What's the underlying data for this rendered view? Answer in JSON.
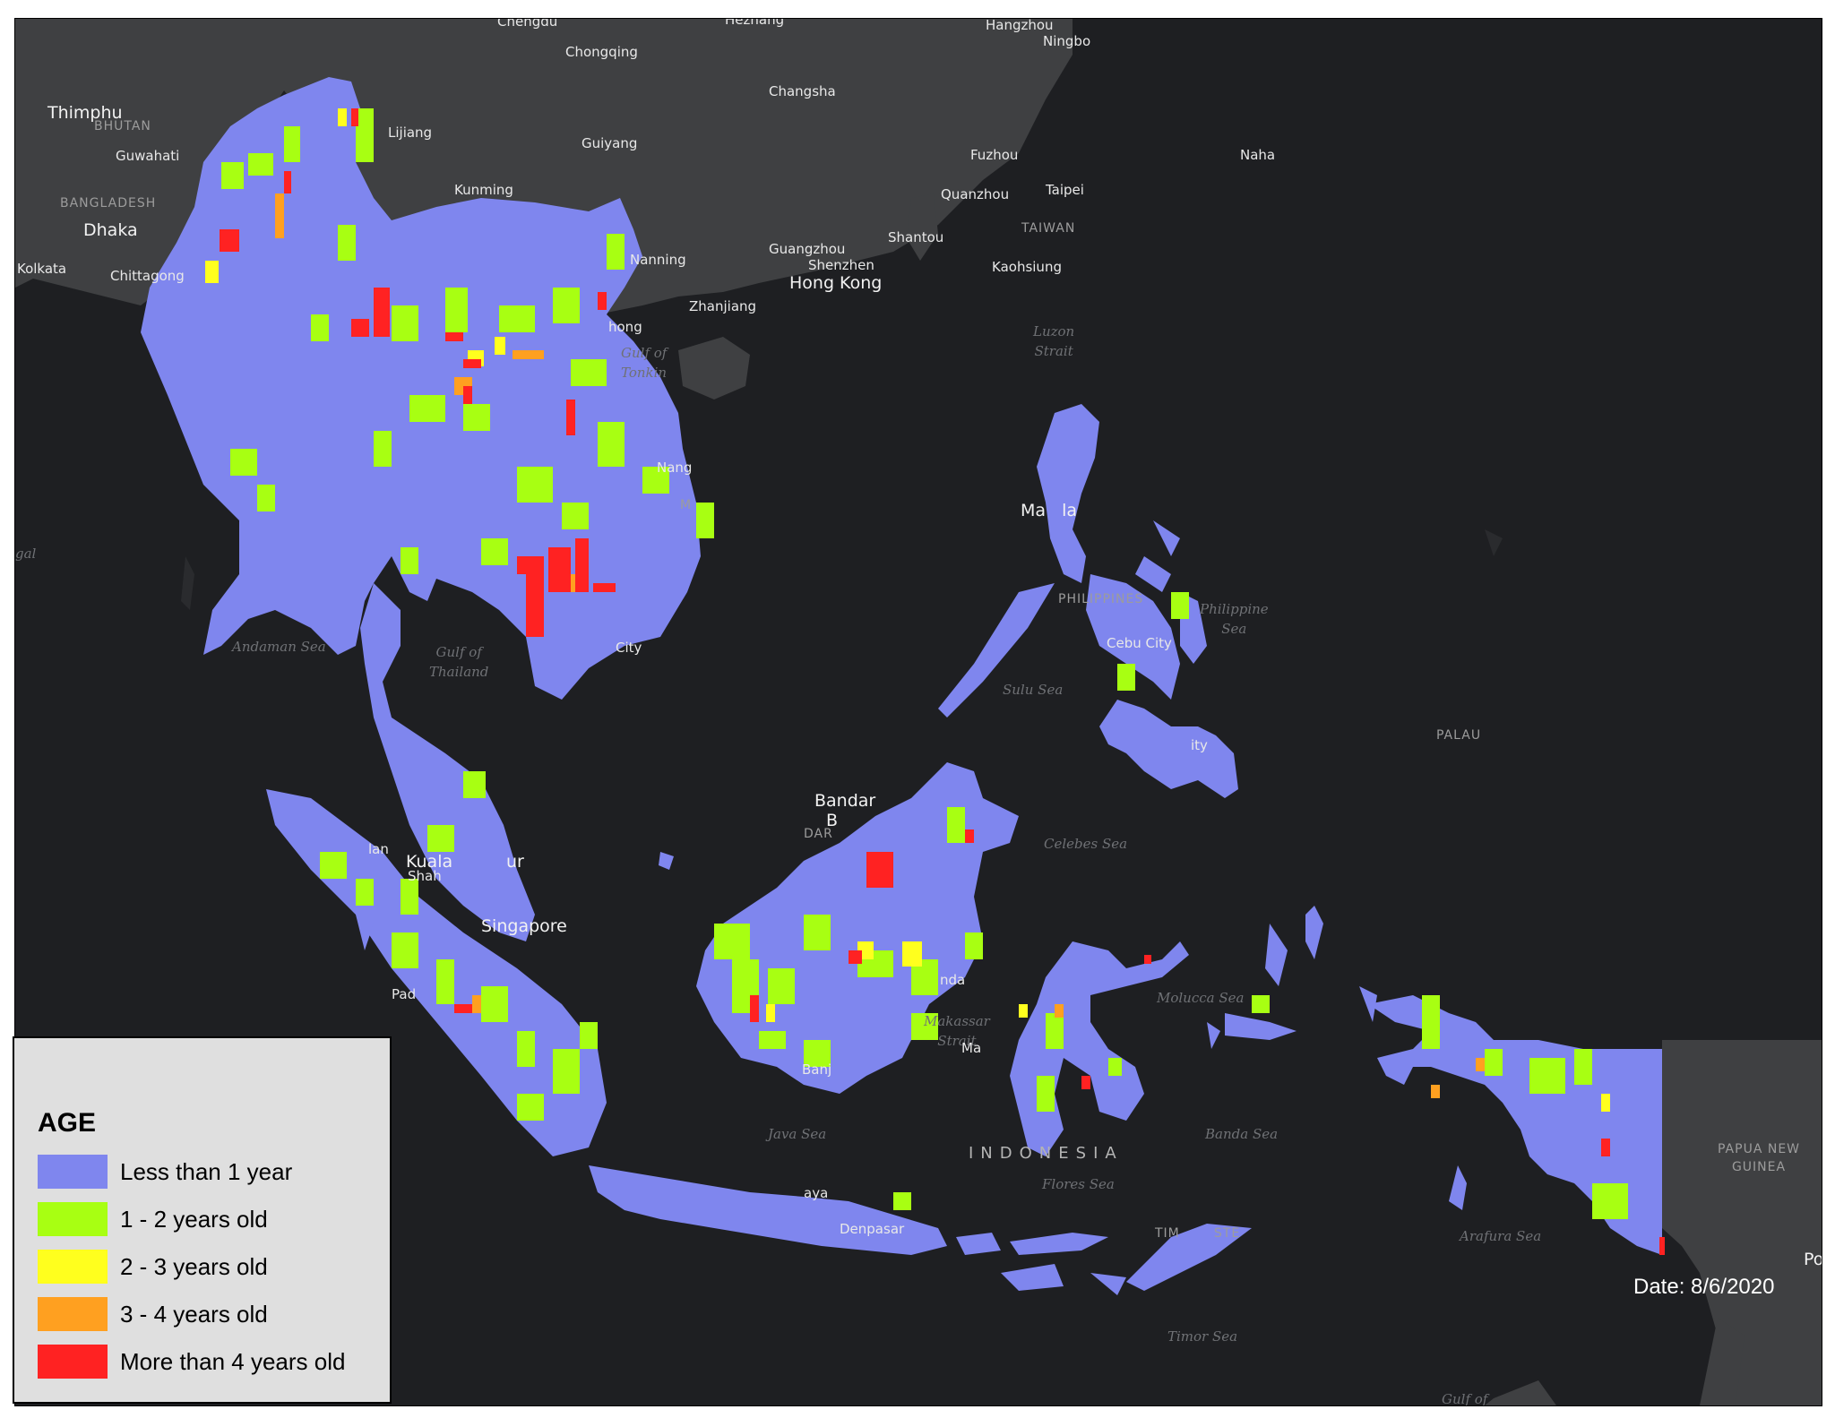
{
  "legend": {
    "title": "AGE",
    "items": [
      {
        "label": "Less than 1 year",
        "color": "#7f86ee"
      },
      {
        "label": "1 - 2 years old",
        "color": "#a8ff12"
      },
      {
        "label": "2 - 3 years old",
        "color": "#ffff1e"
      },
      {
        "label": "3 - 4 years old",
        "color": "#ffa020"
      },
      {
        "label": "More than 4 years old",
        "color": "#ff2222"
      }
    ]
  },
  "date_label": "Date: 8/6/2020",
  "colors": {
    "ocean": "#1e1f22",
    "land_gray": "#3f4042",
    "less_than_1_year": "#7f86ee"
  },
  "labels": {
    "chengdu": "Chengdu",
    "hezhang": "Hezhang",
    "hangzhou": "Hangzhou",
    "ningbo": "Ningbo",
    "chongqing": "Chongqing",
    "changsha": "Changsha",
    "thimphu": "Thimphu",
    "bhutan": "BHUTAN",
    "guwahati": "Guwahati",
    "lijiang": "Lijiang",
    "guiyang": "Guiyang",
    "fuzhou": "Fuzhou",
    "naha": "Naha",
    "bangladesh": "BANGLADESH",
    "kunming": "Kunming",
    "quanzhou": "Quanzhou",
    "taipei": "Taipei",
    "dhaka": "Dhaka",
    "taiwan": "TAIWAN",
    "shantou": "Shantou",
    "kolkata": "Kolkata",
    "chittagong": "Chittagong",
    "nanning": "Nanning",
    "guangzhou": "Guangzhou",
    "shenzhen": "Shenzhen",
    "kaohsiung": "Kaohsiung",
    "hong_kong": "Hong Kong",
    "zhanjiang": "Zhanjiang",
    "hong": "hong",
    "luzon_strait": "Luzon\nStrait",
    "gulf_of_tonkin": "Gulf of\nTonkin",
    "nang": "Nang",
    "vm": "M",
    "gal": "gal",
    "manila": "Ma   la",
    "philippines": "PHILIPPINES",
    "philippine_sea": "Philippine\nSea",
    "andaman_sea": "Andaman Sea",
    "gulf_of_thailand": "Gulf of\nThailand",
    "ho_chi_minh": "City",
    "cebu_city": "Cebu City",
    "sulu_sea": "Sulu Sea",
    "palau": "PALAU",
    "davao": "ity",
    "bandar": "Bandar",
    "bandar_b": "B",
    "dar": "DAR",
    "celebes_sea": "Celebes Sea",
    "kuala": "Kuala",
    "shah": "Shah",
    "lan": "lan",
    "lumpur": "ur",
    "singapore": "Singapore",
    "padang": "Pad",
    "nda": "nda",
    "molucca_sea": "Molucca Sea",
    "makassar_strait": "Makassar\nStrait",
    "makassar": "Ma",
    "banjar": "Banj",
    "java_sea": "Java Sea",
    "indonesia": "INDONESIA",
    "banda_sea": "Banda Sea",
    "papua_new_guinea": "PAPUA NEW\nGUINEA",
    "flores_sea": "Flores Sea",
    "surabaya": "aya",
    "denpasar": "Denpasar",
    "timor_leste": "TIM       STE",
    "arafura_sea": "Arafura Sea",
    "po": "Po",
    "timor_sea": "Timor Sea",
    "gulf_of": "Gulf of"
  }
}
